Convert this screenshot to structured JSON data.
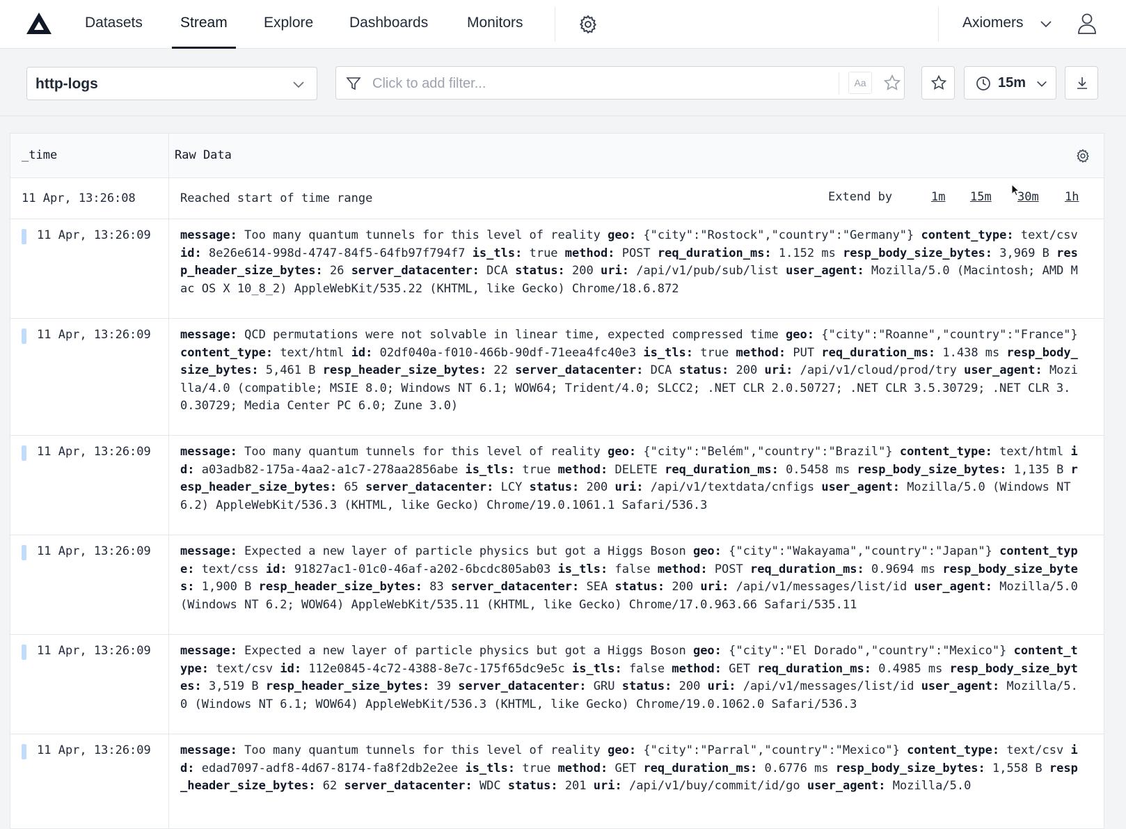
{
  "nav": {
    "items": [
      "Datasets",
      "Stream",
      "Explore",
      "Dashboards",
      "Monitors"
    ],
    "active": "Stream",
    "org": "Axiomers"
  },
  "toolbar": {
    "dataset": "http-logs",
    "filter_placeholder": "Click to add filter...",
    "case_toggle": "Aa",
    "time_range": "15m"
  },
  "table": {
    "columns": [
      "_time",
      "Raw Data"
    ],
    "start_row": {
      "time": "11 Apr, 13:26:08",
      "message": "Reached start of time range",
      "extend_label": "Extend by",
      "extend_options": [
        "1m",
        "15m",
        "30m",
        "1h"
      ]
    },
    "rows": [
      {
        "time": "11 Apr, 13:26:09",
        "fields": [
          [
            "message:",
            "Too many quantum tunnels for this level of reality"
          ],
          [
            "geo:",
            "{\"city\":\"Rostock\",\"country\":\"Germany\"}"
          ],
          [
            "content_type:",
            "text/csv"
          ],
          [
            "id:",
            "8e26e614-998d-4747-84f5-64fb97f794f7"
          ],
          [
            "is_tls:",
            "true"
          ],
          [
            "method:",
            "POST"
          ],
          [
            "req_duration_ms:",
            "1.152 ms"
          ],
          [
            "resp_body_size_bytes:",
            "3,969 B"
          ],
          [
            "resp_header_size_bytes:",
            "26"
          ],
          [
            "server_datacenter:",
            "DCA"
          ],
          [
            "status:",
            "200"
          ],
          [
            "uri:",
            "/api/v1/pub/sub/list"
          ],
          [
            "user_agent:",
            "Mozilla/5.0 (Macintosh; AMD Mac OS X 10_8_2) AppleWebKit/535.22 (KHTML, like Gecko) Chrome/18.6.872"
          ]
        ]
      },
      {
        "time": "11 Apr, 13:26:09",
        "fields": [
          [
            "message:",
            "QCD permutations were not solvable in linear time, expected compressed time"
          ],
          [
            "geo:",
            "{\"city\":\"Roanne\",\"country\":\"France\"}"
          ],
          [
            "content_type:",
            "text/html"
          ],
          [
            "id:",
            "02df040a-f010-466b-90df-71eea4fc40e3"
          ],
          [
            "is_tls:",
            "true"
          ],
          [
            "method:",
            "PUT"
          ],
          [
            "req_duration_ms:",
            "1.438 ms"
          ],
          [
            "resp_body_size_bytes:",
            "5,461 B"
          ],
          [
            "resp_header_size_bytes:",
            "22"
          ],
          [
            "server_datacenter:",
            "DCA"
          ],
          [
            "status:",
            "200"
          ],
          [
            "uri:",
            "/api/v1/cloud/prod/try"
          ],
          [
            "user_agent:",
            "Mozilla/4.0 (compatible; MSIE 8.0; Windows NT 6.1; WOW64; Trident/4.0; SLCC2; .NET CLR 2.0.50727; .NET CLR 3.5.30729; .NET CLR 3.0.30729; Media Center PC 6.0; Zune 3.0)"
          ]
        ]
      },
      {
        "time": "11 Apr, 13:26:09",
        "fields": [
          [
            "message:",
            "Too many quantum tunnels for this level of reality"
          ],
          [
            "geo:",
            "{\"city\":\"Belém\",\"country\":\"Brazil\"}"
          ],
          [
            "content_type:",
            "text/html"
          ],
          [
            "id:",
            "a03adb82-175a-4aa2-a1c7-278aa2856abe"
          ],
          [
            "is_tls:",
            "true"
          ],
          [
            "method:",
            "DELETE"
          ],
          [
            "req_duration_ms:",
            "0.5458 ms"
          ],
          [
            "resp_body_size_bytes:",
            "1,135 B"
          ],
          [
            "resp_header_size_bytes:",
            "65"
          ],
          [
            "server_datacenter:",
            "LCY"
          ],
          [
            "status:",
            "200"
          ],
          [
            "uri:",
            "/api/v1/textdata/cnfigs"
          ],
          [
            "user_agent:",
            "Mozilla/5.0 (Windows NT 6.2) AppleWebKit/536.3 (KHTML, like Gecko) Chrome/19.0.1061.1 Safari/536.3"
          ]
        ]
      },
      {
        "time": "11 Apr, 13:26:09",
        "fields": [
          [
            "message:",
            "Expected a new layer of particle physics but got a Higgs Boson"
          ],
          [
            "geo:",
            "{\"city\":\"Wakayama\",\"country\":\"Japan\"}"
          ],
          [
            "content_type:",
            "text/css"
          ],
          [
            "id:",
            "91827ac1-01c0-46af-a202-6bcdc805ab03"
          ],
          [
            "is_tls:",
            "false"
          ],
          [
            "method:",
            "POST"
          ],
          [
            "req_duration_ms:",
            "0.9694 ms"
          ],
          [
            "resp_body_size_bytes:",
            "1,900 B"
          ],
          [
            "resp_header_size_bytes:",
            "83"
          ],
          [
            "server_datacenter:",
            "SEA"
          ],
          [
            "status:",
            "200"
          ],
          [
            "uri:",
            "/api/v1/messages/list/id"
          ],
          [
            "user_agent:",
            "Mozilla/5.0 (Windows NT 6.2; WOW64) AppleWebKit/535.11 (KHTML, like Gecko) Chrome/17.0.963.66 Safari/535.11"
          ]
        ]
      },
      {
        "time": "11 Apr, 13:26:09",
        "fields": [
          [
            "message:",
            "Expected a new layer of particle physics but got a Higgs Boson"
          ],
          [
            "geo:",
            "{\"city\":\"El Dorado\",\"country\":\"Mexico\"}"
          ],
          [
            "content_type:",
            "text/csv"
          ],
          [
            "id:",
            "112e0845-4c72-4388-8e7c-175f65dc9e5c"
          ],
          [
            "is_tls:",
            "false"
          ],
          [
            "method:",
            "GET"
          ],
          [
            "req_duration_ms:",
            "0.4985 ms"
          ],
          [
            "resp_body_size_bytes:",
            "3,519 B"
          ],
          [
            "resp_header_size_bytes:",
            "39"
          ],
          [
            "server_datacenter:",
            "GRU"
          ],
          [
            "status:",
            "200"
          ],
          [
            "uri:",
            "/api/v1/messages/list/id"
          ],
          [
            "user_agent:",
            "Mozilla/5.0 (Windows NT 6.1; WOW64) AppleWebKit/536.3 (KHTML, like Gecko) Chrome/19.0.1062.0 Safari/536.3"
          ]
        ]
      },
      {
        "time": "11 Apr, 13:26:09",
        "fields": [
          [
            "message:",
            "Too many quantum tunnels for this level of reality"
          ],
          [
            "geo:",
            "{\"city\":\"Parral\",\"country\":\"Mexico\"}"
          ],
          [
            "content_type:",
            "text/csv"
          ],
          [
            "id:",
            "edad7097-adf8-4d67-8174-fa8f2db2e2ee"
          ],
          [
            "is_tls:",
            "true"
          ],
          [
            "method:",
            "GET"
          ],
          [
            "req_duration_ms:",
            "0.6776 ms"
          ],
          [
            "resp_body_size_bytes:",
            "1,558 B"
          ],
          [
            "resp_header_size_bytes:",
            "62"
          ],
          [
            "server_datacenter:",
            "WDC"
          ],
          [
            "status:",
            "201"
          ],
          [
            "uri:",
            "/api/v1/buy/commit/id/go"
          ],
          [
            "user_agent:",
            "Mozilla/5.0"
          ]
        ]
      }
    ]
  }
}
